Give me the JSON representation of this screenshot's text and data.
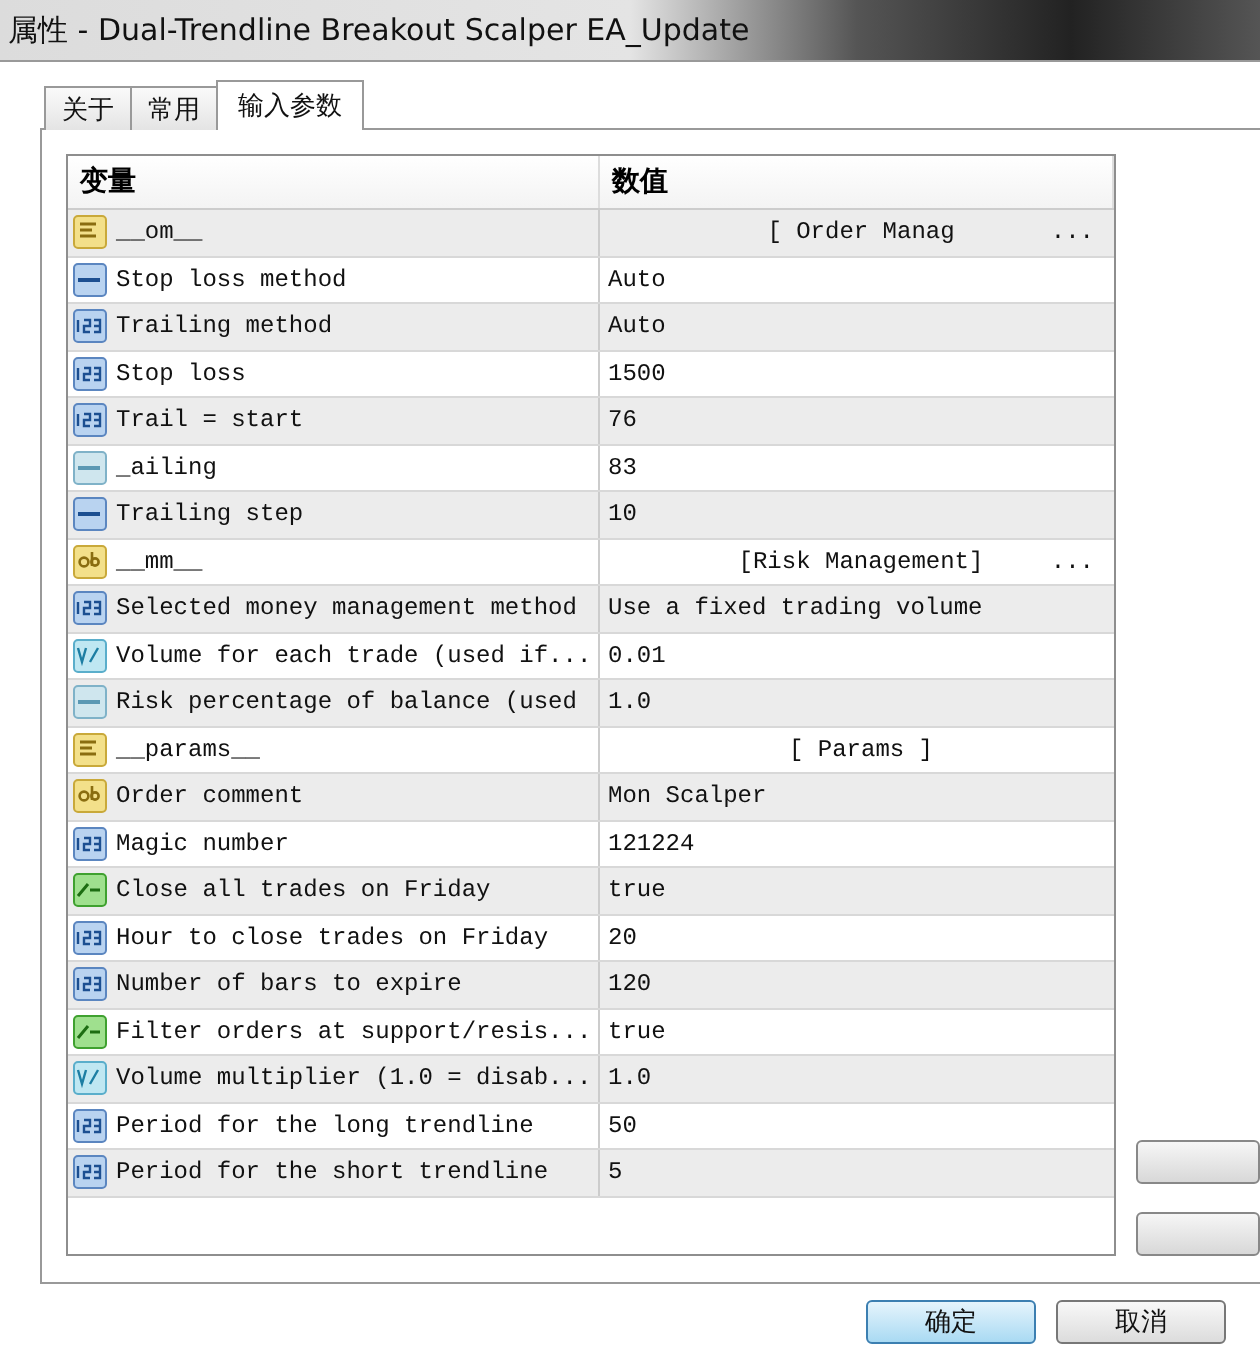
{
  "window": {
    "title": "属性 - Dual-Trendline Breakout Scalper EA_Update"
  },
  "tabs": [
    {
      "label": "关于",
      "selected": false
    },
    {
      "label": "常用",
      "selected": false
    },
    {
      "label": "输入参数",
      "selected": true
    }
  ],
  "table": {
    "columns": [
      "变量",
      "数值"
    ],
    "rows": [
      {
        "kind": "header",
        "name": "__om__",
        "value": "[ Order Manag",
        "more": "..."
      },
      {
        "kind": "enum",
        "name": "Stop loss method",
        "value": "Auto"
      },
      {
        "kind": "int",
        "name": "Trailing method",
        "value": "Auto"
      },
      {
        "kind": "int",
        "name": "Stop loss",
        "value": "1500"
      },
      {
        "kind": "int",
        "name": "Trail = start",
        "value": "76"
      },
      {
        "kind": "color",
        "name": "_ailing",
        "value": "83"
      },
      {
        "kind": "enum",
        "name": "Trailing step",
        "value": "10"
      },
      {
        "kind": "string",
        "name": "__mm__",
        "value": "[Risk Management]",
        "more": "..."
      },
      {
        "kind": "int",
        "name": "Selected money management method",
        "value": "Use a fixed trading volume"
      },
      {
        "kind": "double",
        "name": "Volume for each trade (used if...",
        "value": "0.01"
      },
      {
        "kind": "color",
        "name": "Risk percentage of balance (used",
        "value": "1.0"
      },
      {
        "kind": "header",
        "name": "__params__",
        "value": "[ Params ]"
      },
      {
        "kind": "string",
        "name": "Order comment",
        "value": "Mon Scalper"
      },
      {
        "kind": "int",
        "name": "Magic number",
        "value": "121224"
      },
      {
        "kind": "bool",
        "name": "Close all trades on Friday",
        "value": "true"
      },
      {
        "kind": "int",
        "name": "Hour to close trades on Friday",
        "value": "20"
      },
      {
        "kind": "int",
        "name": "Number of bars to expire",
        "value": "120"
      },
      {
        "kind": "bool",
        "name": "Filter orders at support/resis...",
        "value": "true"
      },
      {
        "kind": "double",
        "name": "Volume multiplier (1.0 = disab...",
        "value": "1.0"
      },
      {
        "kind": "int",
        "name": "Period for the long trendline",
        "value": "50"
      },
      {
        "kind": "int",
        "name": "Period for the short trendline",
        "value": "5"
      }
    ]
  },
  "buttons": [
    {
      "label": "确定",
      "default": true
    },
    {
      "label": "取消",
      "default": false
    }
  ]
}
